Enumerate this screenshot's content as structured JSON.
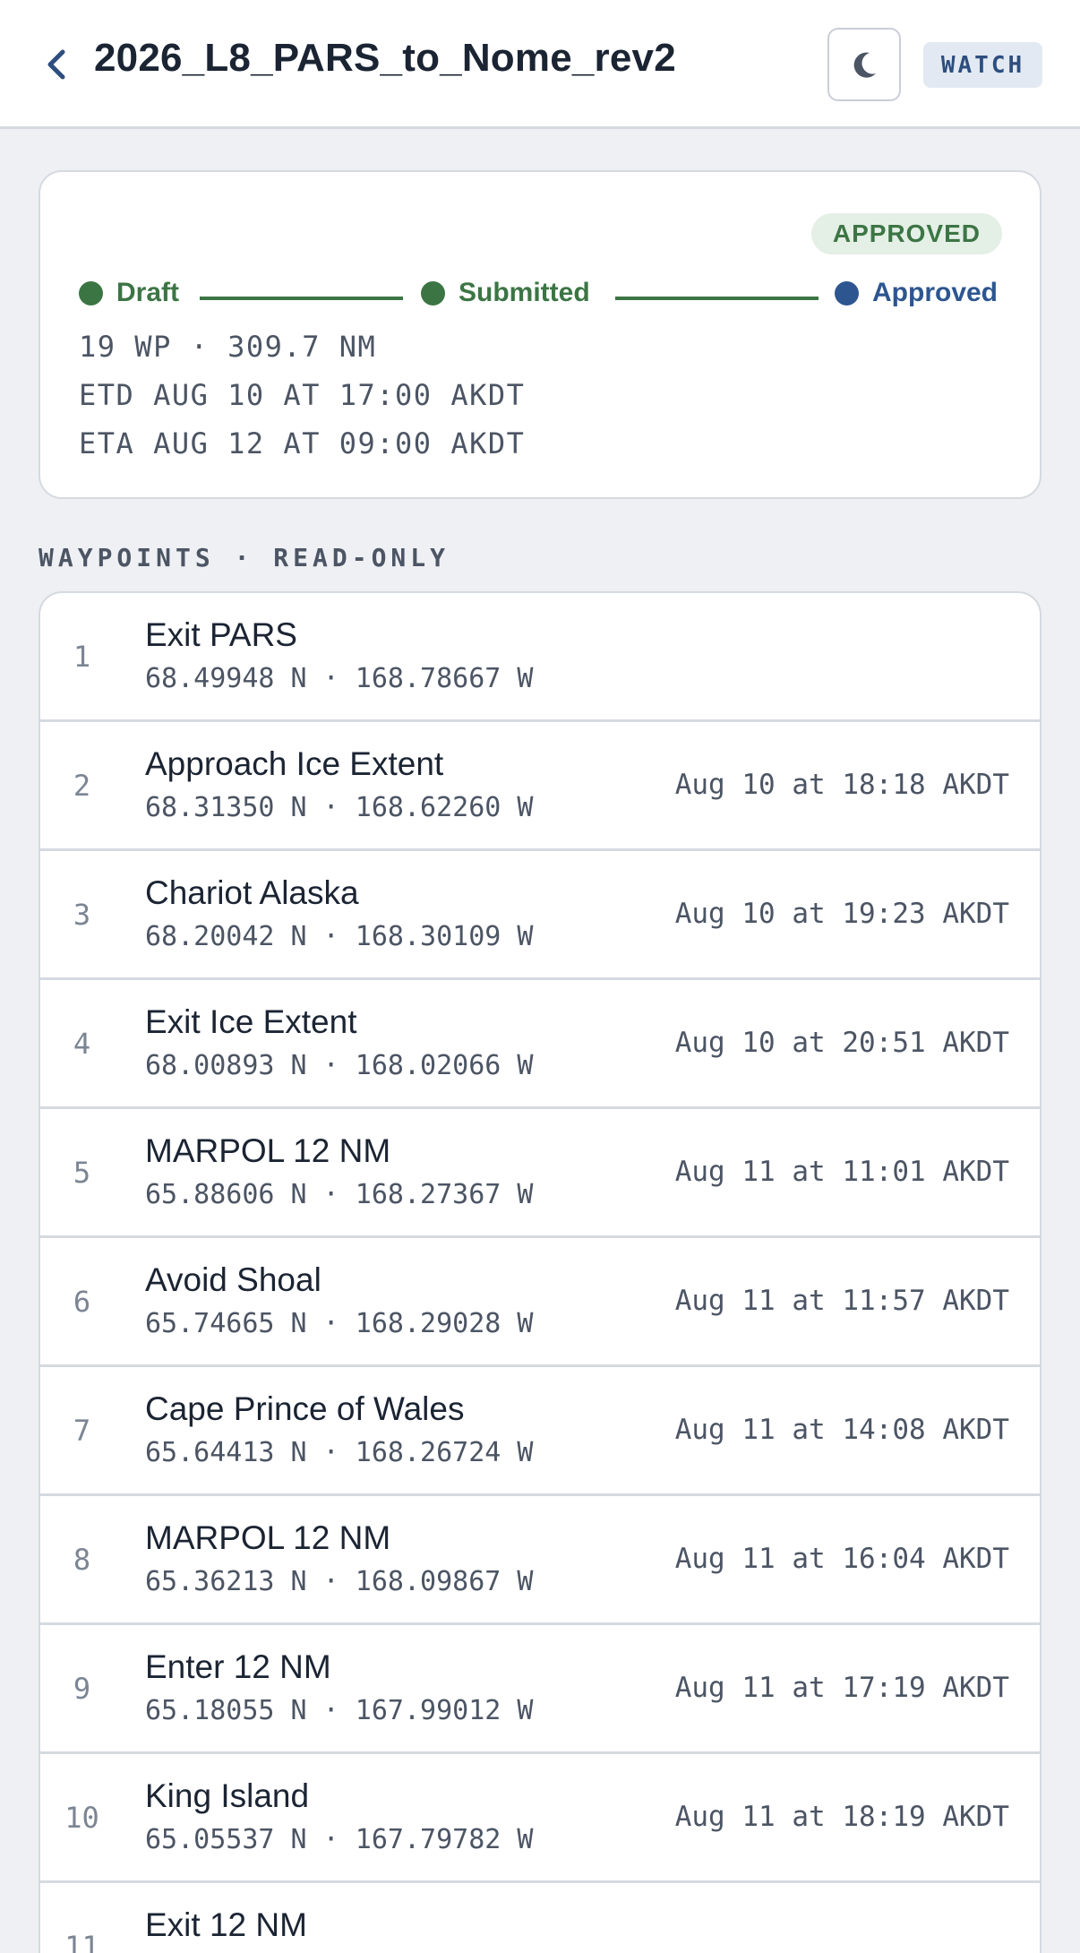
{
  "header": {
    "title": "2026_L8_PARS_to_Nome_rev2",
    "back_icon": "chevron-left-icon",
    "theme_icon": "moon-icon",
    "badge": "WATCH"
  },
  "summary": {
    "status": "APPROVED",
    "stages": [
      {
        "label": "Draft",
        "state": "done"
      },
      {
        "label": "Submitted",
        "state": "done"
      },
      {
        "label": "Approved",
        "state": "current"
      }
    ],
    "lines": [
      "19 WP · 309.7 NM",
      "ETD AUG 10 AT 17:00 AKDT",
      "ETA AUG 12 AT 09:00 AKDT"
    ]
  },
  "colors": {
    "done": "#3c7544",
    "current": "#2d5690",
    "badge_text": "#2d4e7e"
  },
  "waypoints_section": {
    "label": "WAYPOINTS · READ-ONLY"
  },
  "waypoints": [
    {
      "num": "1",
      "name": "Exit PARS",
      "coords": "68.49948 N · 168.78667 W",
      "eta": ""
    },
    {
      "num": "2",
      "name": "Approach Ice Extent",
      "coords": "68.31350 N · 168.62260 W",
      "eta": "Aug 10 at 18:18 AKDT"
    },
    {
      "num": "3",
      "name": "Chariot Alaska",
      "coords": "68.20042 N · 168.30109 W",
      "eta": "Aug 10 at 19:23 AKDT"
    },
    {
      "num": "4",
      "name": "Exit Ice Extent",
      "coords": "68.00893 N · 168.02066 W",
      "eta": "Aug 10 at 20:51 AKDT"
    },
    {
      "num": "5",
      "name": "MARPOL 12 NM",
      "coords": "65.88606 N · 168.27367 W",
      "eta": "Aug 11 at 11:01 AKDT"
    },
    {
      "num": "6",
      "name": "Avoid Shoal",
      "coords": "65.74665 N · 168.29028 W",
      "eta": "Aug 11 at 11:57 AKDT"
    },
    {
      "num": "7",
      "name": "Cape Prince of Wales",
      "coords": "65.64413 N · 168.26724 W",
      "eta": "Aug 11 at 14:08 AKDT"
    },
    {
      "num": "8",
      "name": "MARPOL 12 NM",
      "coords": "65.36213 N · 168.09867 W",
      "eta": "Aug 11 at 16:04 AKDT"
    },
    {
      "num": "9",
      "name": "Enter 12 NM",
      "coords": "65.18055 N · 167.99012 W",
      "eta": "Aug 11 at 17:19 AKDT"
    },
    {
      "num": "10",
      "name": "King Island",
      "coords": "65.05537 N · 167.79782 W",
      "eta": "Aug 11 at 18:19 AKDT"
    },
    {
      "num": "11",
      "name": "Exit 12 NM",
      "coords": "",
      "eta": ""
    }
  ]
}
